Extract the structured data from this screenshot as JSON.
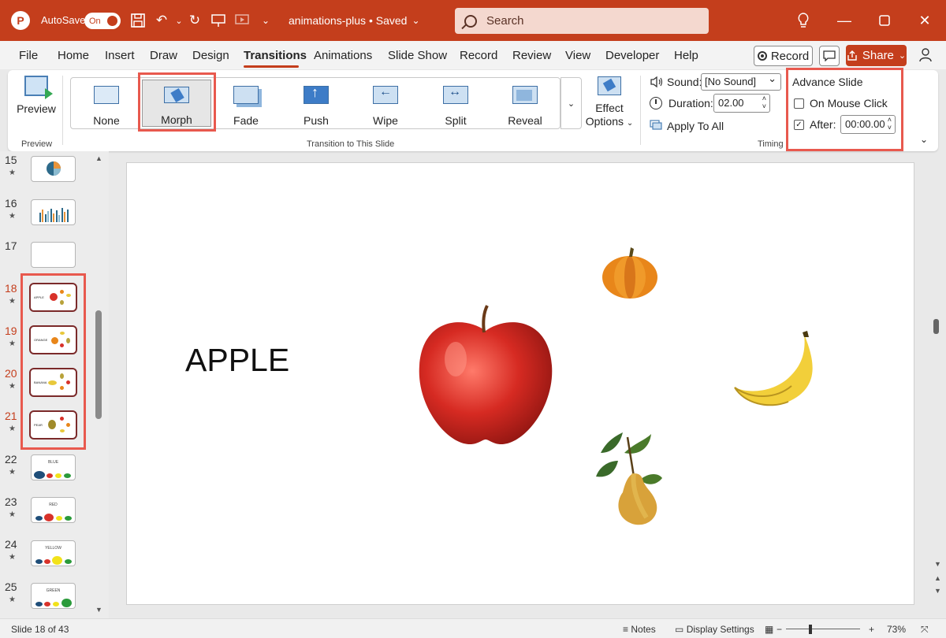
{
  "titlebar": {
    "logo": "P",
    "autosave_label": "AutoSave",
    "autosave_state": "On",
    "document_title": "animations-plus • Saved",
    "search_placeholder": "Search"
  },
  "menu": {
    "items": [
      "File",
      "Home",
      "Insert",
      "Draw",
      "Design",
      "Transitions",
      "Animations",
      "Slide Show",
      "Record",
      "Review",
      "View",
      "Developer",
      "Help"
    ],
    "active": "Transitions",
    "record_label": "Record",
    "share_label": "Share"
  },
  "ribbon": {
    "preview_label": "Preview",
    "preview_group": "Preview",
    "transitions": [
      "None",
      "Morph",
      "Fade",
      "Push",
      "Wipe",
      "Split",
      "Reveal"
    ],
    "selected_transition": "Morph",
    "transition_group": "Transition to This Slide",
    "effect_options_line1": "Effect",
    "effect_options_line2": "Options",
    "timing": {
      "sound_label": "Sound:",
      "sound_value": "[No Sound]",
      "duration_label": "Duration:",
      "duration_value": "02.00",
      "apply_all": "Apply To All",
      "group": "Timing"
    },
    "advance": {
      "title": "Advance Slide",
      "on_click_label": "On Mouse Click",
      "on_click_checked": false,
      "after_label": "After:",
      "after_checked": true,
      "after_value": "00:00.00"
    }
  },
  "slides": [
    {
      "num": "15",
      "text": ""
    },
    {
      "num": "16",
      "text": ""
    },
    {
      "num": "17",
      "text": ""
    },
    {
      "num": "18",
      "text": "APPLE"
    },
    {
      "num": "19",
      "text": "ORANGE"
    },
    {
      "num": "20",
      "text": "BANANA"
    },
    {
      "num": "21",
      "text": "PEAR"
    },
    {
      "num": "22",
      "text": "BLUE"
    },
    {
      "num": "23",
      "text": "RED"
    },
    {
      "num": "24",
      "text": "YELLOW"
    },
    {
      "num": "25",
      "text": "GREEN"
    }
  ],
  "slide": {
    "heading": "APPLE"
  },
  "status": {
    "slide_info": "Slide 18 of 43",
    "notes": "Notes",
    "display_settings": "Display Settings",
    "zoom": "73%"
  },
  "colors": {
    "accent": "#c43e1c",
    "highlight": "#e8594e"
  }
}
